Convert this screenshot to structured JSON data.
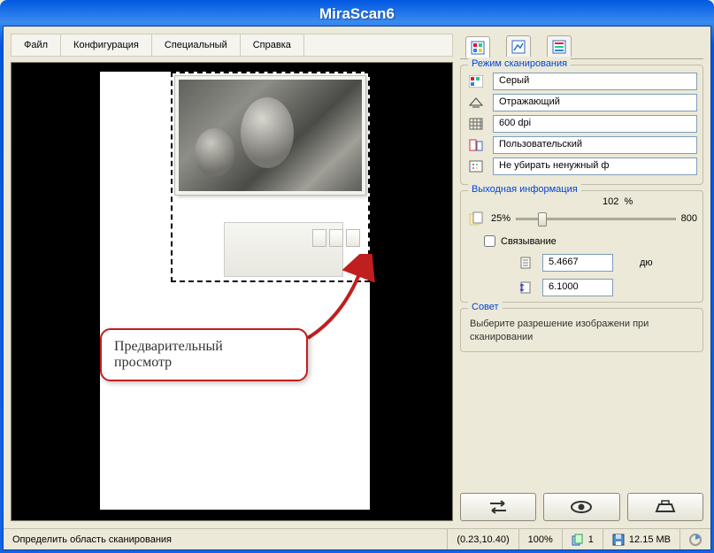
{
  "window": {
    "title": "MiraScan6"
  },
  "menu": {
    "file": "Файл",
    "config": "Конфигурация",
    "special": "Специальный",
    "help": "Справка"
  },
  "callout": {
    "line1": "Предварительный",
    "line2": "просмотр"
  },
  "scan_mode": {
    "legend": "Режим сканирования",
    "color_mode": "Серый",
    "source": "Отражающий",
    "resolution": "600 dpi",
    "size": "Пользовательский",
    "descreen": "Не убирать ненужный ф"
  },
  "output": {
    "legend": "Выходная информация",
    "scale_pct": "102",
    "pct_sign": "%",
    "min_label": "25%",
    "max_label": "800",
    "link_label": "Связывание",
    "width": "5.4667",
    "height": "6.1000",
    "unit": "дю"
  },
  "tip": {
    "legend": "Совет",
    "text": "Выберите разрешение изображени при сканировании"
  },
  "status": {
    "hint": "Определить область сканирования",
    "coords": "(0.23,10.40)",
    "zoom": "100%",
    "pages": "1",
    "memory": "12.15 MB"
  }
}
